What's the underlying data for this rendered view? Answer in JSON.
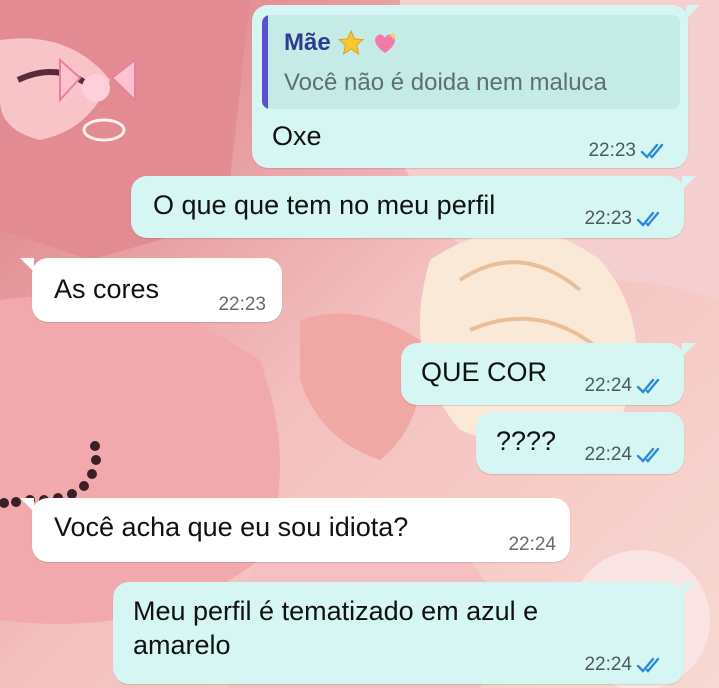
{
  "messages": [
    {
      "direction": "outgoing",
      "reply": {
        "author": "Mãe",
        "author_emojis": [
          "star-emoji",
          "sparkling-heart-emoji"
        ],
        "text": "Você não é doida nem maluca"
      },
      "text": "Oxe",
      "time": "22:23",
      "status": "read"
    },
    {
      "direction": "outgoing",
      "text": "O que que tem no meu perfil",
      "time": "22:23",
      "status": "read"
    },
    {
      "direction": "incoming",
      "text": "As cores",
      "time": "22:23"
    },
    {
      "direction": "outgoing",
      "text": "QUE COR",
      "time": "22:24",
      "status": "read"
    },
    {
      "direction": "outgoing",
      "text": "????",
      "time": "22:24",
      "status": "read"
    },
    {
      "direction": "incoming",
      "text": "Você acha que eu sou idiota?",
      "time": "22:24"
    },
    {
      "direction": "outgoing",
      "text": "Meu perfil é tematizado em azul e\namarelo",
      "time": "22:24",
      "status": "read"
    }
  ],
  "colors": {
    "outgoing_bubble": "#d6f6f3",
    "incoming_bubble": "#ffffff",
    "read_check": "#2f8ad8",
    "reply_bar": "#5a4fd0"
  }
}
